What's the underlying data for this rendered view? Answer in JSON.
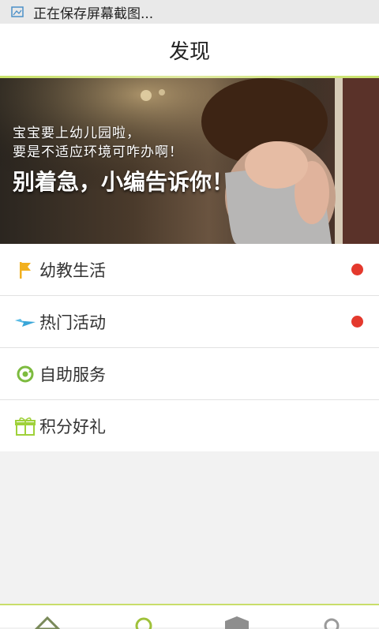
{
  "status_bar": {
    "text": "正在保存屏幕截图..."
  },
  "header": {
    "title": "发现"
  },
  "banner": {
    "line1": "宝宝要上幼儿园啦，",
    "line2": "要是不适应环境可咋办啊！",
    "headline": "别着急，小编告诉你！"
  },
  "menu": {
    "items": [
      {
        "label": "幼教生活",
        "icon": "flag-icon",
        "badge": true
      },
      {
        "label": "热门活动",
        "icon": "plane-icon",
        "badge": true
      },
      {
        "label": "自助服务",
        "icon": "refresh-coin-icon",
        "badge": false
      },
      {
        "label": "积分好礼",
        "icon": "gift-icon",
        "badge": false
      }
    ]
  },
  "colors": {
    "accent": "#c9de6a",
    "badge": "#e4392d",
    "flag": "#f2b01e",
    "plane": "#3aa6d8",
    "service": "#7dbb3f",
    "gift": "#9fd13a"
  }
}
